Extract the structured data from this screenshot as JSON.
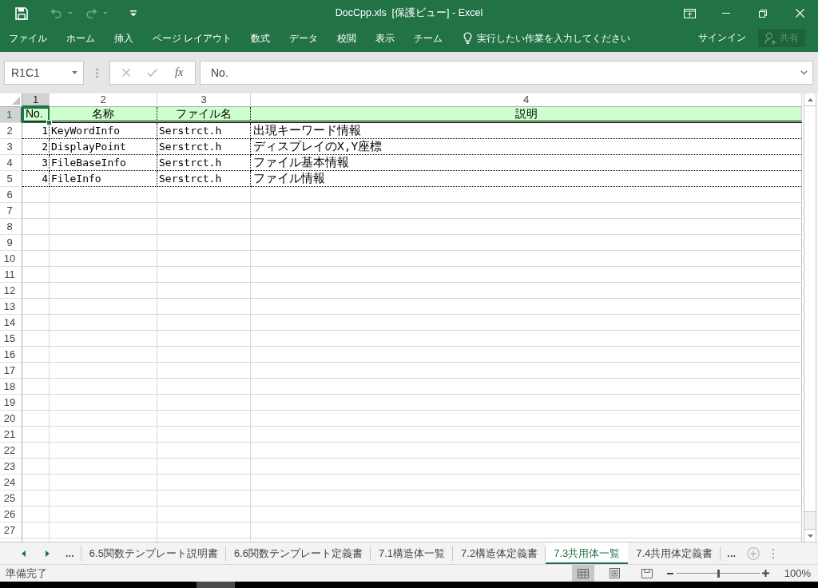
{
  "title_bar": {
    "quick_access": [
      {
        "kind": "save",
        "disabled": false
      },
      {
        "kind": "undo",
        "disabled": true
      },
      {
        "kind": "redo",
        "disabled": true
      },
      {
        "kind": "customize",
        "disabled": false
      }
    ],
    "title": "DocCpp.xls  [保護ビュー] - Excel"
  },
  "ribbon": {
    "tabs": [
      "ファイル",
      "ホーム",
      "挿入",
      "ページ レイアウト",
      "数式",
      "データ",
      "校閲",
      "表示",
      "チーム"
    ],
    "tell_me": "実行したい作業を入力してください",
    "sign_in": "サインイン",
    "share": {
      "label": "共有",
      "disabled": true
    }
  },
  "formula_bar": {
    "name_box": "R1C1",
    "function_button": "fx",
    "formula": "No."
  },
  "grid": {
    "columns": [
      {
        "label": "1",
        "selected": true
      },
      {
        "label": "2",
        "selected": false
      },
      {
        "label": "3",
        "selected": false
      },
      {
        "label": "4",
        "selected": false
      }
    ],
    "rows": [
      {
        "label": "1",
        "selected": true,
        "kind": "header",
        "cells": [
          {
            "text": "No.",
            "selected": true
          },
          {
            "text": "名称",
            "selected": false
          },
          {
            "text": "ファイル名",
            "selected": false
          },
          {
            "text": "説明",
            "selected": false
          }
        ]
      },
      {
        "label": "2",
        "selected": false,
        "kind": "data",
        "cells": [
          {
            "text": "1",
            "selected": false
          },
          {
            "text": "KeyWordInfo",
            "selected": false
          },
          {
            "text": "Serstrct.h",
            "selected": false
          },
          {
            "text": "出現キーワード情報",
            "selected": false
          }
        ]
      },
      {
        "label": "3",
        "selected": false,
        "kind": "data",
        "cells": [
          {
            "text": "2",
            "selected": false
          },
          {
            "text": "DisplayPoint",
            "selected": false
          },
          {
            "text": "Serstrct.h",
            "selected": false
          },
          {
            "text": "ディスプレイのX,Y座標",
            "selected": false
          }
        ]
      },
      {
        "label": "4",
        "selected": false,
        "kind": "data",
        "cells": [
          {
            "text": "3",
            "selected": false
          },
          {
            "text": "FileBaseInfo",
            "selected": false
          },
          {
            "text": "Serstrct.h",
            "selected": false
          },
          {
            "text": "ファイル基本情報",
            "selected": false
          }
        ]
      },
      {
        "label": "5",
        "selected": false,
        "kind": "data",
        "cells": [
          {
            "text": "4",
            "selected": false
          },
          {
            "text": "FileInfo",
            "selected": false
          },
          {
            "text": "Serstrct.h",
            "selected": false
          },
          {
            "text": "ファイル情報",
            "selected": false
          }
        ]
      },
      {
        "label": "6",
        "selected": false,
        "kind": "empty"
      },
      {
        "label": "7",
        "selected": false,
        "kind": "empty"
      },
      {
        "label": "8",
        "selected": false,
        "kind": "empty"
      },
      {
        "label": "9",
        "selected": false,
        "kind": "empty"
      },
      {
        "label": "10",
        "selected": false,
        "kind": "empty"
      },
      {
        "label": "11",
        "selected": false,
        "kind": "empty"
      },
      {
        "label": "12",
        "selected": false,
        "kind": "empty"
      },
      {
        "label": "13",
        "selected": false,
        "kind": "empty"
      },
      {
        "label": "14",
        "selected": false,
        "kind": "empty"
      },
      {
        "label": "15",
        "selected": false,
        "kind": "empty"
      },
      {
        "label": "16",
        "selected": false,
        "kind": "empty"
      },
      {
        "label": "17",
        "selected": false,
        "kind": "empty"
      },
      {
        "label": "18",
        "selected": false,
        "kind": "empty"
      },
      {
        "label": "19",
        "selected": false,
        "kind": "empty"
      },
      {
        "label": "20",
        "selected": false,
        "kind": "empty"
      },
      {
        "label": "21",
        "selected": false,
        "kind": "empty"
      },
      {
        "label": "22",
        "selected": false,
        "kind": "empty"
      },
      {
        "label": "23",
        "selected": false,
        "kind": "empty"
      },
      {
        "label": "24",
        "selected": false,
        "kind": "empty"
      },
      {
        "label": "25",
        "selected": false,
        "kind": "empty"
      },
      {
        "label": "26",
        "selected": false,
        "kind": "empty"
      },
      {
        "label": "27",
        "selected": false,
        "kind": "empty"
      }
    ]
  },
  "sheet_tabs": {
    "more_left": "...",
    "tabs": [
      {
        "label": "6.5関数テンプレート説明書",
        "selected": false
      },
      {
        "label": "6.6関数テンプレート定義書",
        "selected": false
      },
      {
        "label": "7.1構造体一覧",
        "selected": false
      },
      {
        "label": "7.2構造体定義書",
        "selected": false
      },
      {
        "label": "7.3共用体一覧",
        "selected": true
      },
      {
        "label": "7.4共用体定義書",
        "selected": false
      }
    ],
    "more_right": "..."
  },
  "status_bar": {
    "status": "準備完了",
    "views": [
      {
        "kind": "normal",
        "selected": true
      },
      {
        "kind": "page_layout",
        "selected": false
      },
      {
        "kind": "page_break",
        "selected": false
      }
    ],
    "zoom": {
      "level": 0.5,
      "reading": "100%"
    }
  }
}
